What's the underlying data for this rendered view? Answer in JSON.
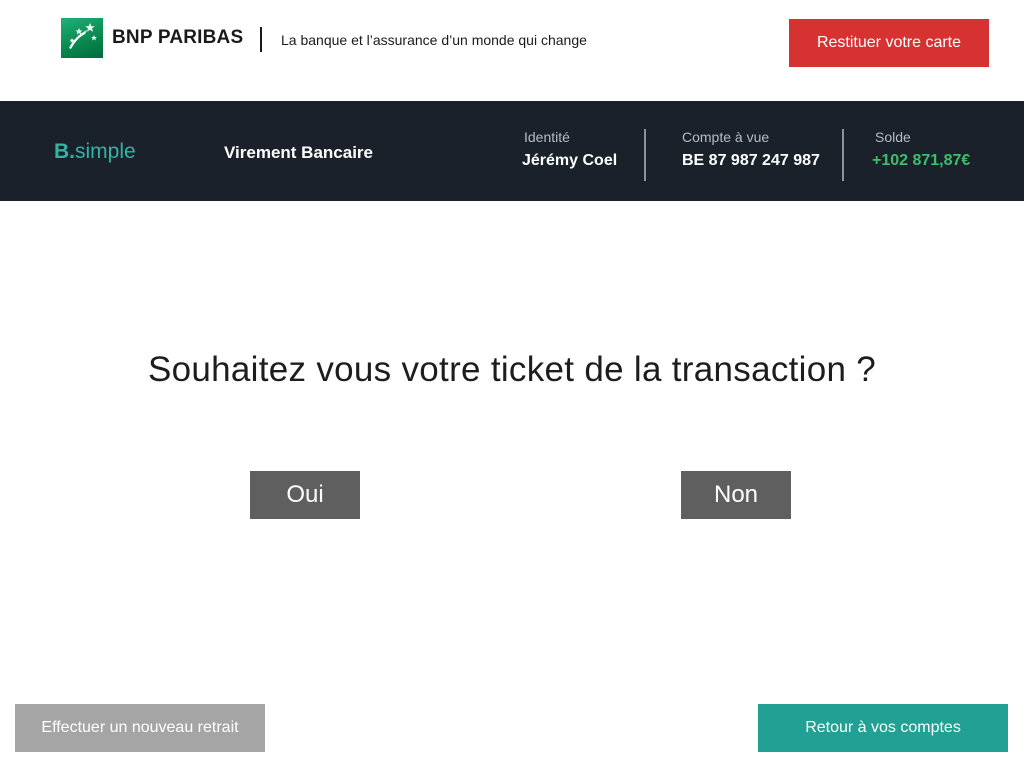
{
  "brand": {
    "name": "BNP PARIBAS",
    "tagline": "La banque et l’assurance d’un monde qui change",
    "return_card_label": "Restituer votre carte"
  },
  "header": {
    "product_logo_b": "B",
    "product_logo_dot": ".",
    "product_logo_rest": "simple",
    "section_title": "Virement Bancaire",
    "identity_label": "Identité",
    "identity_value": "Jérémy Coel",
    "account_label": "Compte à vue",
    "account_value": "BE 87 987 247 987",
    "balance_label": "Solde",
    "balance_value": "+102 871,87€"
  },
  "main": {
    "question": "Souhaitez vous votre ticket de la transaction ?",
    "yes_label": "Oui",
    "no_label": "Non"
  },
  "footer": {
    "new_withdrawal_label": "Effectuer un nouveau retrait",
    "back_accounts_label": "Retour à vos comptes"
  },
  "colors": {
    "brand_green": "#0a8a4f",
    "return_card_red": "#d63232",
    "header_bg": "#1a212b",
    "product_teal": "#33b3a3",
    "balance_green": "#3cbf6b",
    "choice_gray": "#5f5f5f",
    "secondary_gray": "#a5a5a5",
    "primary_teal": "#22a093"
  },
  "icons": {
    "brand_logo": "bnp-stars-logo-icon"
  }
}
